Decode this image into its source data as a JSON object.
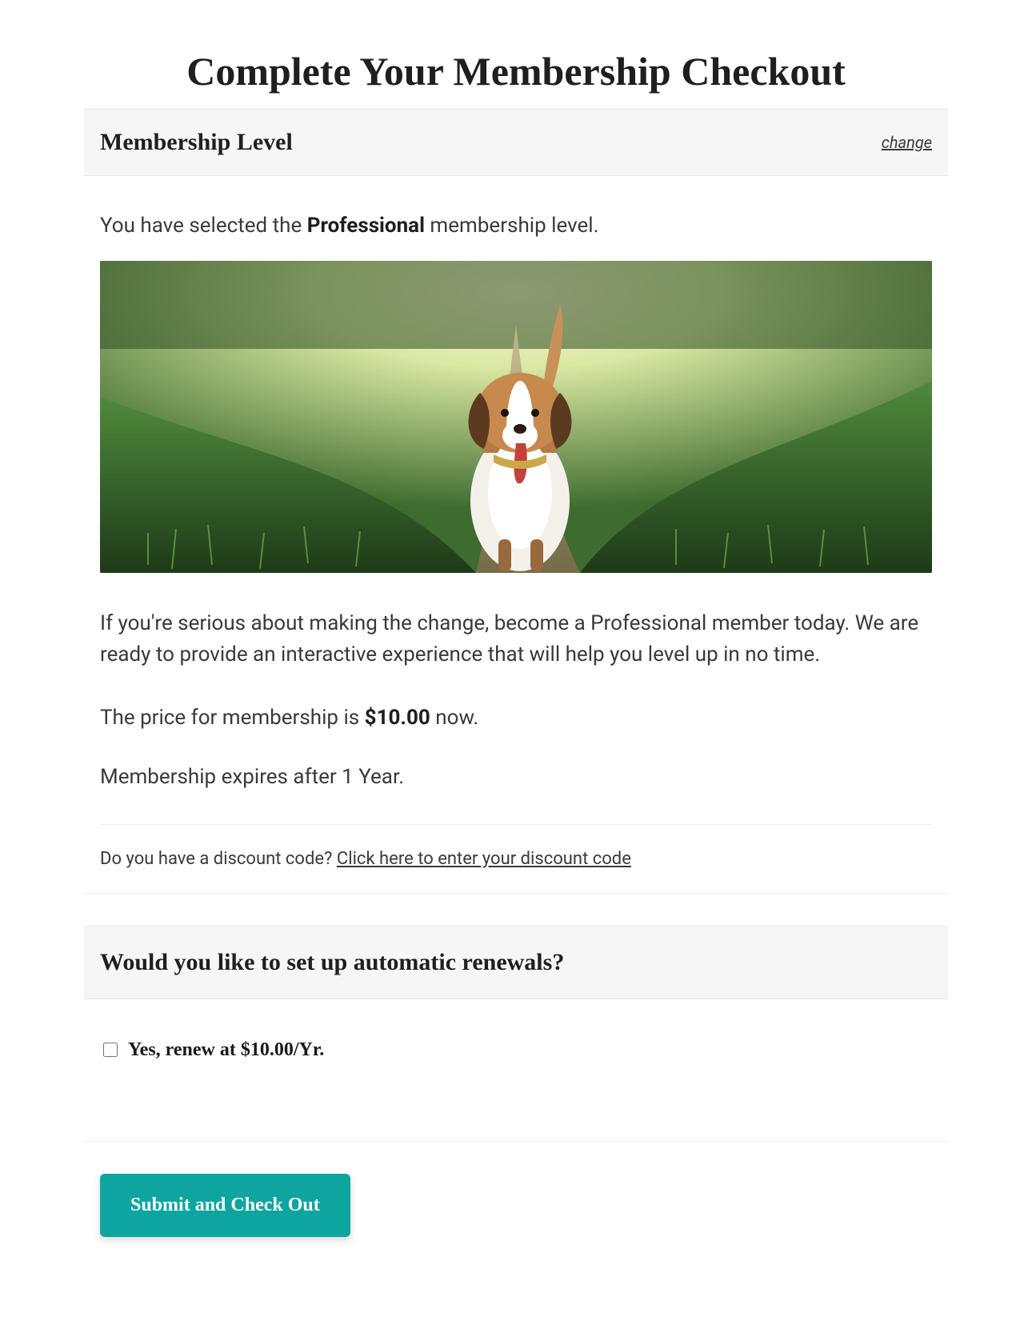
{
  "page": {
    "title": "Complete Your Membership Checkout"
  },
  "membership": {
    "section_heading": "Membership Level",
    "change_link": "change",
    "selected_prefix": "You have selected the ",
    "selected_level": "Professional",
    "selected_suffix": " membership level.",
    "description": "If you're serious about making the change, become a Professional member today. We are ready to provide an interactive experience that will help you level up in no time.",
    "price_prefix": "The price for membership is ",
    "price": "$10.00",
    "price_suffix": " now.",
    "expires": "Membership expires after 1 Year."
  },
  "discount": {
    "prompt": "Do you have a discount code? ",
    "link": "Click here to enter your discount code"
  },
  "renewal": {
    "heading": "Would you like to set up automatic renewals?",
    "checkbox_label": "Yes, renew at $10.00/Yr."
  },
  "actions": {
    "submit": "Submit and Check Out"
  },
  "image": {
    "alt": "dog-running-on-trail"
  }
}
